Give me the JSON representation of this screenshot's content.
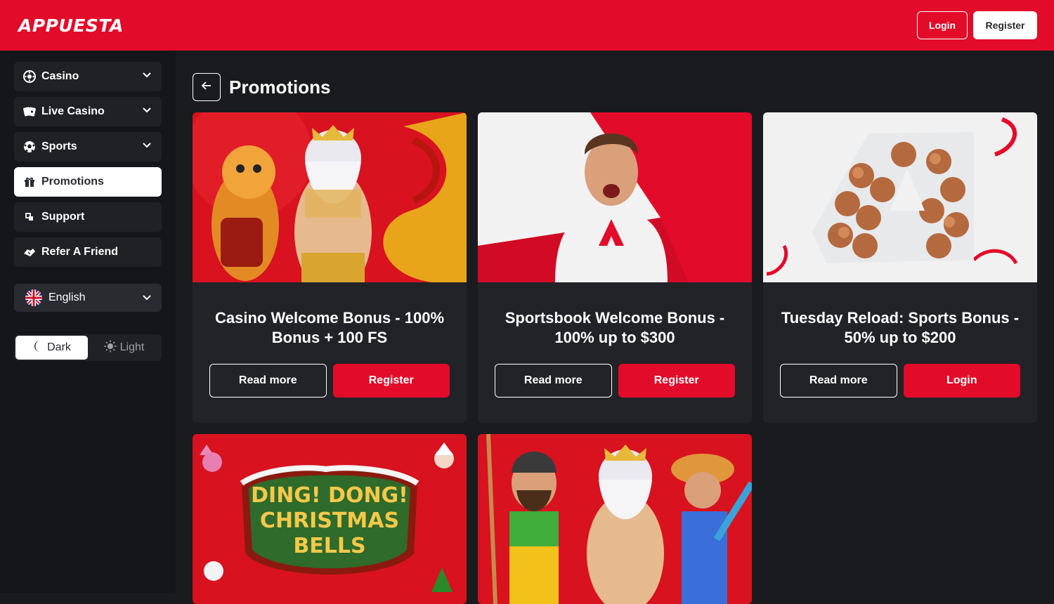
{
  "brand": {
    "logo_text": "APPUESTA",
    "accent": "#e30b2a"
  },
  "header": {
    "login_label": "Login",
    "register_label": "Register"
  },
  "sidebar": {
    "items": [
      {
        "label": "Casino",
        "icon": "roulette-icon",
        "expandable": true
      },
      {
        "label": "Live Casino",
        "icon": "cards-icon",
        "expandable": true
      },
      {
        "label": "Sports",
        "icon": "soccer-ball-icon",
        "expandable": true
      },
      {
        "label": "Promotions",
        "icon": "gift-icon",
        "active": true
      },
      {
        "label": "Support",
        "icon": "support-icon"
      },
      {
        "label": "Refer A Friend",
        "icon": "handshake-icon"
      }
    ],
    "language": {
      "label": "English",
      "icon": "uk-flag-icon"
    },
    "theme": {
      "dark_label": "Dark",
      "light_label": "Light",
      "selected": "Dark"
    }
  },
  "main": {
    "page_title": "Promotions",
    "promotions": [
      {
        "title": "Casino Welcome Bonus - 100% Bonus + 100 FS",
        "read_more": "Read more",
        "cta": "Register"
      },
      {
        "title": "Sportsbook Welcome Bonus - 100% up to $300",
        "read_more": "Read more",
        "cta": "Register"
      },
      {
        "title": "Tuesday Reload: Sports Bonus - 50% up to $200",
        "read_more": "Read more",
        "cta": "Login"
      },
      {
        "image_text": [
          "DING! DONG!",
          "CHRISTMAS",
          "BELLS"
        ]
      },
      {}
    ]
  }
}
